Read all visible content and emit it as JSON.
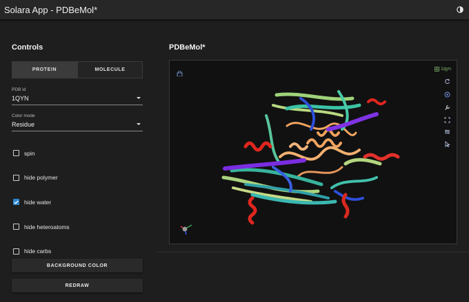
{
  "app": {
    "title": "Solara App - PDBeMol*",
    "theme_icon": "moon-sun-icon"
  },
  "controls": {
    "heading": "Controls",
    "tabs": [
      {
        "label": "PROTEIN",
        "active": true
      },
      {
        "label": "MOLECULE",
        "active": false
      }
    ],
    "pdb_id": {
      "label": "PDB id",
      "value": "1QYN"
    },
    "color_mode": {
      "label": "Color mode",
      "value": "Residue"
    },
    "checkboxes": [
      {
        "label": "spin",
        "checked": false
      },
      {
        "label": "hide polymer",
        "checked": false
      },
      {
        "label": "hide water",
        "checked": true
      },
      {
        "label": "hide heteroatoms",
        "checked": false
      },
      {
        "label": "hide carbs",
        "checked": false
      }
    ],
    "background_button": "BACKGROUND COLOR",
    "redraw_button": "REDRAW"
  },
  "viewer": {
    "heading": "PDBeMol*",
    "structure_tag": "1qyn",
    "toolbar": [
      "reset-icon",
      "center-icon",
      "settings-icon",
      "fullscreen-icon",
      "controls-icon",
      "select-icon"
    ],
    "colors": {
      "accent": "#2f86d3",
      "helix": "#e0261f",
      "strand_teal": "#3cc3a6",
      "strand_purple": "#7a2de0",
      "strand_green": "#9fd27a",
      "loop_orange": "#f0a460",
      "blue": "#2d4fd8"
    }
  }
}
